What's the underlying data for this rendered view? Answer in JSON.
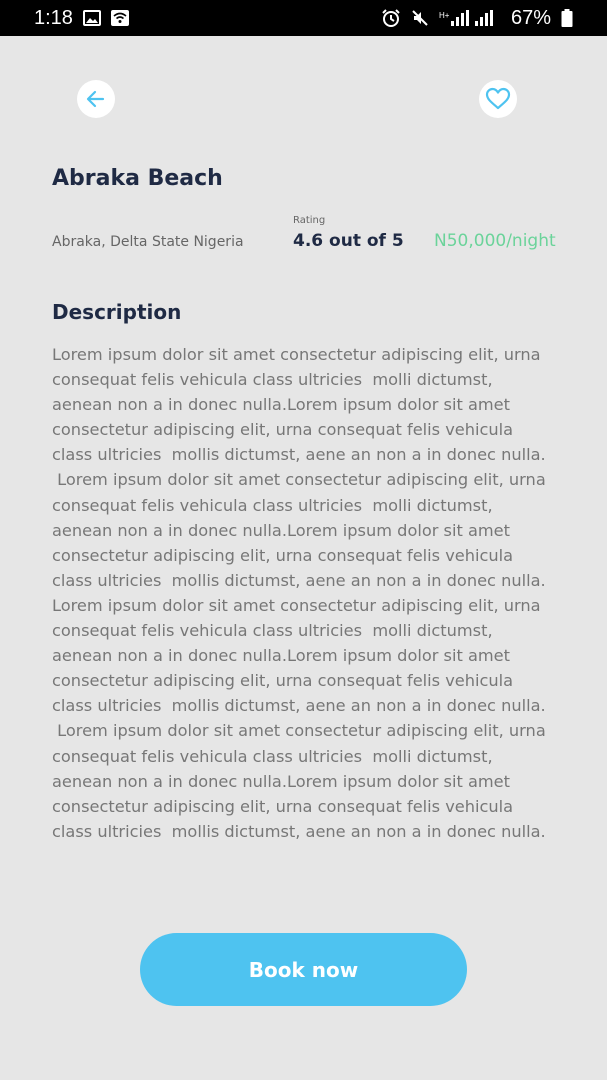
{
  "status_bar": {
    "time": "1:18",
    "battery_percent": "67%",
    "icons_left": [
      "image-icon",
      "wifi-icon"
    ],
    "icons_right": [
      "alarm-icon",
      "mute-icon",
      "signal-icon",
      "battery-icon"
    ]
  },
  "header": {
    "back_icon": "arrow-left-icon",
    "favorite_icon": "heart-icon",
    "accent_color": "#4ec3f0"
  },
  "listing": {
    "title": "Abraka Beach",
    "location": "Abraka, Delta State Nigeria",
    "rating_label": "Rating",
    "rating_value": "4.6 out of 5",
    "price": "N50,000/night",
    "price_color": "#6bd39a"
  },
  "description": {
    "heading": "Description",
    "lines": [
      "Lorem ipsum dolor sit amet consectetur adipiscing elit, urna",
      "consequat felis vehicula class ultricies  molli dictumst,",
      "aenean non a in donec nulla.Lorem ipsum dolor sit amet",
      "consectetur adipiscing elit, urna consequat felis vehicula",
      "class ultricies  mollis dictumst, aene an non a in donec nulla.",
      " Lorem ipsum dolor sit amet consectetur adipiscing elit, urna",
      "consequat felis vehicula class ultricies  molli dictumst,",
      "aenean non a in donec nulla.Lorem ipsum dolor sit amet",
      "consectetur adipiscing elit, urna consequat felis vehicula",
      "class ultricies  mollis dictumst, aene an non a in donec nulla.",
      "Lorem ipsum dolor sit amet consectetur adipiscing elit, urna",
      "consequat felis vehicula class ultricies  molli dictumst,",
      "aenean non a in donec nulla.Lorem ipsum dolor sit amet",
      "consectetur adipiscing elit, urna consequat felis vehicula",
      "class ultricies  mollis dictumst, aene an non a in donec nulla.",
      " Lorem ipsum dolor sit amet consectetur adipiscing elit, urna",
      "consequat felis vehicula class ultricies  molli dictumst,",
      "aenean non a in donec nulla.Lorem ipsum dolor sit amet",
      "consectetur adipiscing elit, urna consequat felis vehicula",
      "class ultricies  mollis dictumst, aene an non a in donec nulla."
    ]
  },
  "actions": {
    "book_label": "Book now"
  }
}
